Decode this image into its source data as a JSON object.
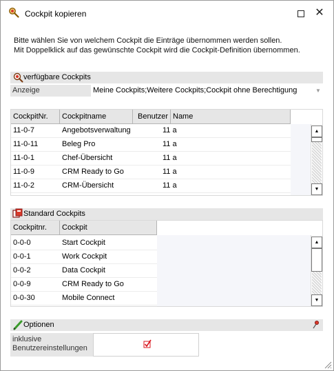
{
  "window": {
    "title": "Cockpit kopieren",
    "title_icon": "magnifier-key-icon",
    "maximize_icon": "maximize-icon",
    "close_icon": "close-icon",
    "close_glyph": "✕"
  },
  "intro": {
    "line1": "Bitte wählen Sie von welchem Cockpit die Einträge übernommen werden sollen.",
    "line2": "Mit Doppelklick auf das gewünschte Cockpit wird die Cockpit-Definition übernommen."
  },
  "available": {
    "header": "verfügbare Cockpits",
    "icon": "cockpit-search-icon",
    "filter_label": "Anzeige",
    "filter_value": "Meine Cockpits;Weitere Cockpits;Cockpit ohne Berechtigung",
    "filter_arrow": "▼",
    "columns": [
      "CockpitNr.",
      "Cockpitname",
      "Benutzer",
      "Name"
    ],
    "rows": [
      {
        "nr": "11-0-7",
        "name": "Angebotsverwaltung",
        "user": "11 a",
        "username": ""
      },
      {
        "nr": "11-0-11",
        "name": "Beleg Pro",
        "user": "11 a",
        "username": ""
      },
      {
        "nr": "11-0-1",
        "name": "Chef-Übersicht",
        "user": "11 a",
        "username": ""
      },
      {
        "nr": "11-0-9",
        "name": "CRM Ready to Go",
        "user": "11 a",
        "username": ""
      },
      {
        "nr": "11-0-2",
        "name": "CRM-Übersicht",
        "user": "11 a",
        "username": ""
      }
    ]
  },
  "standard": {
    "header": "Standard Cockpits",
    "icon": "standard-cockpit-icon",
    "columns": [
      "Cockpitnr.",
      "Cockpit"
    ],
    "rows": [
      {
        "nr": "0-0-0",
        "name": "Start Cockpit"
      },
      {
        "nr": "0-0-1",
        "name": "Work Cockpit"
      },
      {
        "nr": "0-0-2",
        "name": "Data Cockpit"
      },
      {
        "nr": "0-0-9",
        "name": "CRM Ready to Go"
      },
      {
        "nr": "0-0-30",
        "name": "Mobile Connect"
      }
    ]
  },
  "options": {
    "header": "Optionen",
    "icon": "pencil-icon",
    "pin_icon": "pin-icon",
    "include_user_settings_label_line1": "inklusive",
    "include_user_settings_label_line2": "Benutzereinstellungen",
    "include_user_settings_checked": true
  },
  "scroll": {
    "up": "▲",
    "down": "▼"
  },
  "colors": {
    "header_bg": "#e6e6e6",
    "check_red": "#d9141c",
    "pencil_green": "#3a9b2a"
  }
}
